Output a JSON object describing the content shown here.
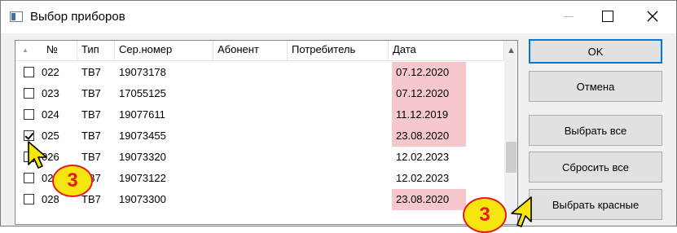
{
  "window": {
    "title": "Выбор приборов"
  },
  "table": {
    "columns": [
      "№",
      "Тип",
      "Сер.номер",
      "Абонент",
      "Потребитель",
      "Дата"
    ],
    "rows": [
      {
        "checked": false,
        "num": "022",
        "type": "ТВ7",
        "serial": "19073178",
        "subscriber": "",
        "consumer": "",
        "date": "07.12.2020",
        "highlight": true
      },
      {
        "checked": false,
        "num": "023",
        "type": "ТВ7",
        "serial": "17055125",
        "subscriber": "",
        "consumer": "",
        "date": "07.12.2020",
        "highlight": true
      },
      {
        "checked": false,
        "num": "024",
        "type": "ТВ7",
        "serial": "19077611",
        "subscriber": "",
        "consumer": "",
        "date": "11.12.2019",
        "highlight": true
      },
      {
        "checked": true,
        "num": "025",
        "type": "ТВ7",
        "serial": "19073455",
        "subscriber": "",
        "consumer": "",
        "date": "23.08.2020",
        "highlight": true
      },
      {
        "checked": false,
        "num": "026",
        "type": "ТВ7",
        "serial": "19073320",
        "subscriber": "",
        "consumer": "",
        "date": "12.02.2023",
        "highlight": false
      },
      {
        "checked": false,
        "num": "027",
        "type": "ТВ7",
        "serial": "19073122",
        "subscriber": "",
        "consumer": "",
        "date": "12.02.2023",
        "highlight": false
      },
      {
        "checked": false,
        "num": "028",
        "type": "ТВ7",
        "serial": "19073300",
        "subscriber": "",
        "consumer": "",
        "date": "23.08.2020",
        "highlight": true
      }
    ]
  },
  "buttons": {
    "ok": "OK",
    "cancel": "Отмена",
    "select_all": "Выбрать все",
    "reset_all": "Сбросить все",
    "select_red": "Выбрать красные"
  },
  "annotations": {
    "badge_left": "3",
    "badge_right": "3"
  },
  "colors": {
    "highlight": "#f6c8ce",
    "badge_fill": "#f6e60f",
    "badge_border": "#e8191f"
  }
}
